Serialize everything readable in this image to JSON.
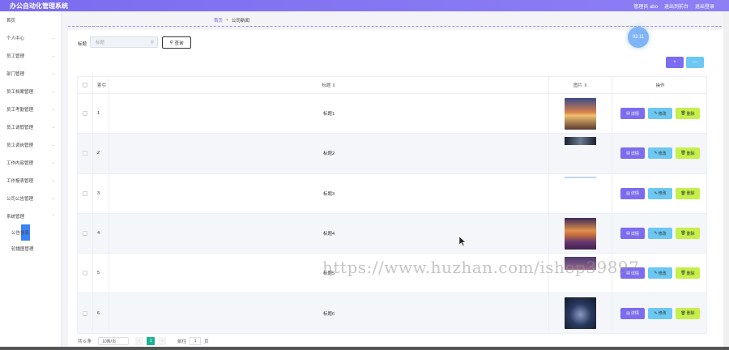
{
  "app": {
    "title": "办公自动化管理系统"
  },
  "topbar": {
    "user": "管理员 abo",
    "back_front": "退出到前台",
    "logout": "退出登录"
  },
  "sidebar": {
    "home": "首页",
    "items": [
      {
        "label": "个人中心"
      },
      {
        "label": "员工管理"
      },
      {
        "label": "部门管理"
      },
      {
        "label": "员工档案管理"
      },
      {
        "label": "员工考勤管理"
      },
      {
        "label": "员工请假管理"
      },
      {
        "label": "员工调岗管理"
      },
      {
        "label": "工作内容管理"
      },
      {
        "label": "工作报表管理"
      },
      {
        "label": "公司公告管理"
      },
      {
        "label": "系统管理"
      }
    ],
    "submenu": [
      {
        "label": "公告信息"
      },
      {
        "label": "轮播图管理"
      }
    ]
  },
  "breadcrumb": {
    "home": "首页",
    "current": "公司新闻"
  },
  "clock": "03:11",
  "search": {
    "label": "标题",
    "placeholder": "标题",
    "button": "查询"
  },
  "toolbar": {
    "add": "+",
    "batch_delete": "—"
  },
  "table": {
    "headers": {
      "index": "索引",
      "title": "标题 ⇕",
      "image": "图片 ⇕",
      "ops": "操作"
    },
    "rows": [
      {
        "index": "1",
        "title": "标题1",
        "img": "sunset"
      },
      {
        "index": "2",
        "title": "标题2",
        "img": "strip"
      },
      {
        "index": "3",
        "title": "标题3",
        "img": "blank"
      },
      {
        "index": "4",
        "title": "标题4",
        "img": "lavender"
      },
      {
        "index": "5",
        "title": "标题5",
        "img": "strip2"
      },
      {
        "index": "6",
        "title": "标题6",
        "img": "night"
      }
    ],
    "ops": {
      "detail": "详情",
      "edit": "修改",
      "delete": "删除"
    }
  },
  "pager": {
    "total": "共 6 条",
    "page_size": "10条/页",
    "prev": "‹",
    "page": "1",
    "next": "›",
    "goto_label": "前往",
    "goto_value": "1",
    "page_unit": "页"
  },
  "watermark": "https://www.huzhan.com/ishop39897",
  "colors": {
    "primary": "#7b6cf0",
    "cyan": "#6cc8f2",
    "lime": "#c5f04a",
    "pager_active": "#1ab394"
  }
}
